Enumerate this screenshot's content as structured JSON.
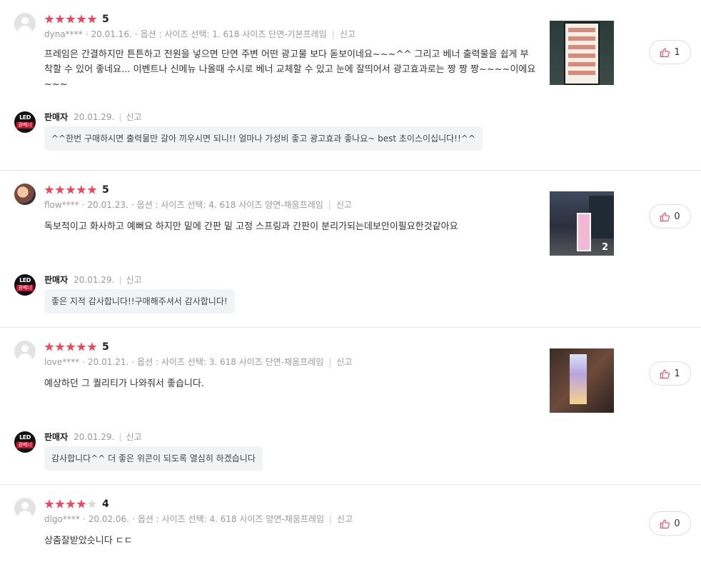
{
  "reviews": [
    {
      "avatar": "default-avatar",
      "rating": "5",
      "user": "dyna****",
      "date": "20.01.16.",
      "option": "옵션 : 사이즈 선택: 1. 618 사이즈 단면-기본프레임",
      "report": "신고",
      "content": "프레임은 간결하지만 튼튼하고 전원을 넣으면 단연 주변 어떤 광고물 보다 돋보이네요~~~^^ 그리고 베너 출력물을 쉽게 부착할 수 있어 좋네요... 이벤트나 신메뉴 나올때 수시로 베너 교체할 수 있고 눈에 잘띄어서 광고효과로는 짱 짱 짱~~~~이에요~~~",
      "likes": "1",
      "photo_count": "",
      "seller": {
        "name": "판매자",
        "date": "20.01.29.",
        "report": "신고",
        "reply": "^^한번 구매하시면 출력물만 갈아 끼우시면 되니!! 얼마나 가성비 좋고 광고효과 좋나요~ best 초이스이십니다!!^^"
      }
    },
    {
      "avatar": "user-photo-avatar",
      "rating": "5",
      "user": "flow****",
      "date": "20.01.23.",
      "option": "옵션 : 사이즈 선택: 4. 618 사이즈 양면-채움프레임",
      "report": "신고",
      "content": "독보적이고 화사하고 예뻐요 하지만 밑에 간판 밑 고정 스프링과 간판이 분리가되는데보안이필요한것같아요",
      "likes": "0",
      "photo_count": "2",
      "seller": {
        "name": "판매자",
        "date": "20.01.29.",
        "report": "신고",
        "reply": "좋은 지적 감사합니다!!구매해주셔서 감사합니다!"
      }
    },
    {
      "avatar": "default-avatar",
      "rating": "5",
      "user": "love****",
      "date": "20.01.21.",
      "option": "옵션 : 사이즈 선택: 3. 618 사이즈 단면-채움프레임",
      "report": "신고",
      "content": "예상하던 그 퀄리티가 나와줘서 좋습니다.",
      "likes": "1",
      "photo_count": "",
      "seller": {
        "name": "판매자",
        "date": "20.01.29.",
        "report": "신고",
        "reply": "감사합니다^^ 더 좋은 위콘이 되도록 열심히 하겠습니다"
      }
    },
    {
      "avatar": "default-avatar",
      "rating": "4",
      "user": "dlgo****",
      "date": "20.02.06.",
      "option": "옵션 : 사이즈 선택: 4. 618 사이즈 양면-채움프레임",
      "report": "신고",
      "content": "상춤잘받았슷니다 ㄷㄷ",
      "likes": "0",
      "photo_count": ""
    }
  ],
  "seller_logo": {
    "line1": "LED",
    "line2": "광베너"
  },
  "colors": {
    "star_on": "#f0455a",
    "star_off": "#d8d8d8",
    "like_icon": "#f0455a"
  }
}
